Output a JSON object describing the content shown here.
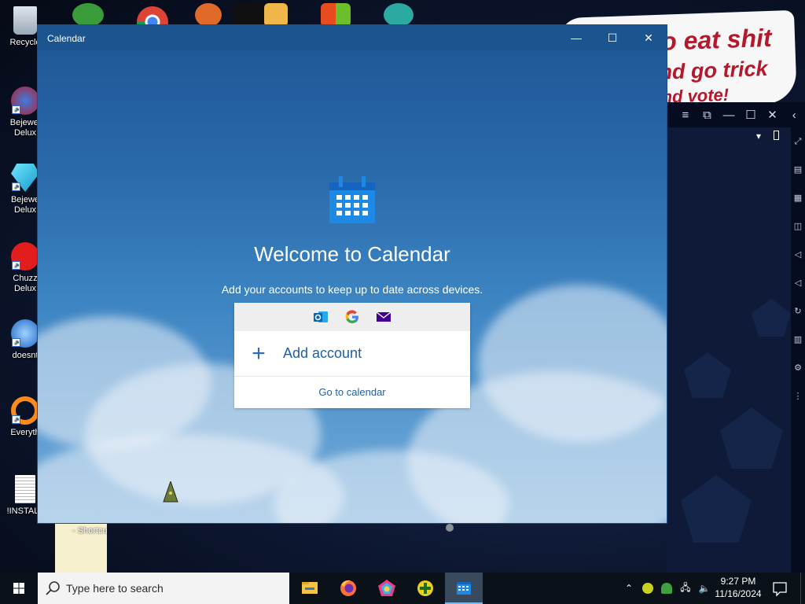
{
  "desktop": {
    "icons": [
      {
        "label": "Recycle",
        "icon": "recycle-bin-icon"
      },
      {
        "label": "Bejewel Delux",
        "icon": "bejeweled-2-icon"
      },
      {
        "label": "Bejewe Delux",
        "icon": "bejeweled-diamond-icon"
      },
      {
        "label": "Chuzz Delux",
        "icon": "chuzzle-icon"
      },
      {
        "label": "doesnt",
        "icon": "globe-app-icon"
      },
      {
        "label": "Everyth",
        "icon": "everything-search-icon"
      },
      {
        "label": "!INSTALL",
        "icon": "text-document-icon"
      }
    ],
    "note_label": "- Shortcu",
    "banner": {
      "line1": "o eat shit",
      "line2": "nd go trick",
      "line3": "nd vote!"
    }
  },
  "calendar_window": {
    "title": "Calendar",
    "controls": {
      "minimize": "—",
      "maximize": "☐",
      "close": "✕"
    },
    "welcome": "Welcome to Calendar",
    "subtitle": "Add your accounts to keep up to date across devices.",
    "providers": [
      "outlook-icon",
      "google-icon",
      "mail-icon"
    ],
    "add_account_plus": "+",
    "add_account": "Add account",
    "go_to_calendar": "Go to calendar"
  },
  "emulator_window": {
    "controls": [
      "≡",
      "⧉",
      "—",
      "☐",
      "✕",
      "‹"
    ]
  },
  "taskbar": {
    "search_placeholder": "Type here to search",
    "apps": [
      "file-explorer-icon",
      "firefox-icon",
      "chromium-icon",
      "green-plus-app-icon",
      "calendar-icon"
    ],
    "active_app": "calendar-icon",
    "clock": {
      "time": "9:27 PM",
      "date": "11/16/2024"
    }
  },
  "colors": {
    "accent": "#1f5fa6",
    "titlebar": "#1b548f",
    "taskbar": "#0b1118"
  }
}
